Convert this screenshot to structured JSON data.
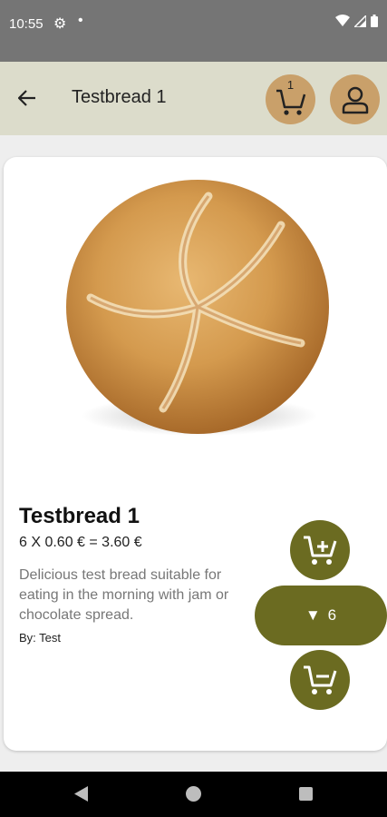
{
  "status_bar": {
    "time": "10:55",
    "icons": [
      "gear-icon",
      "dot-icon",
      "wifi-icon",
      "signal-icon",
      "battery-icon"
    ]
  },
  "app_bar": {
    "title": "Testbread 1",
    "cart_count": "1",
    "icons": [
      "arrow-left-icon",
      "cart-icon",
      "user-icon"
    ]
  },
  "product": {
    "name": "Testbread 1",
    "price_line": "6 X 0.60 € = 3.60 €",
    "description": "Delicious test bread suitable for eating in the morning with jam or chocolate spread.",
    "author": "By: Test",
    "quantity": "6",
    "quantity_arrow": "▼",
    "image": "bread-roll"
  },
  "colors": {
    "app_bar_bg": "#dcdccb",
    "accent_tan": "#c9a06a",
    "button_olive": "#6b6b21",
    "status_bar_bg": "#757575"
  }
}
